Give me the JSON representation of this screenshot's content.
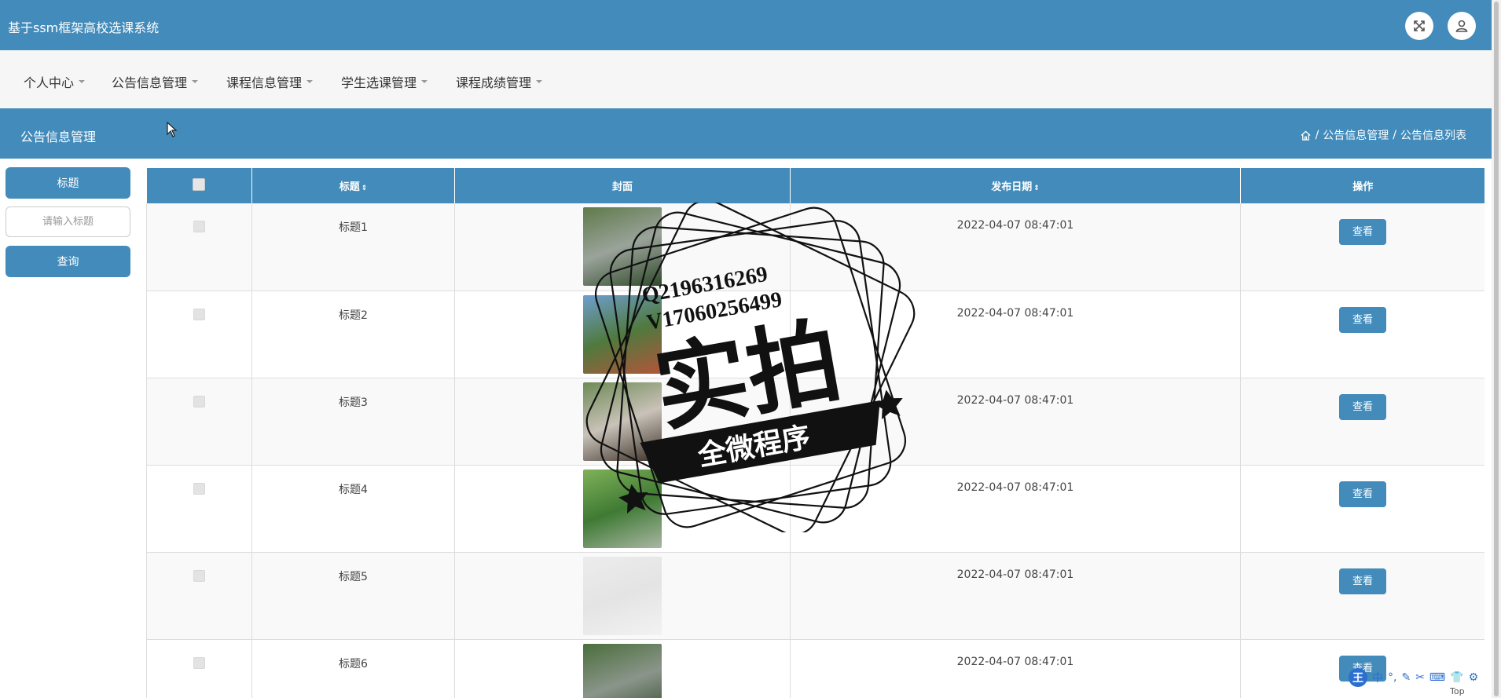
{
  "header": {
    "app_title": "基于ssm框架高校选课系统",
    "fullscreen_icon": "expand-icon",
    "user_icon": "user-icon"
  },
  "nav": {
    "items": [
      {
        "label": "个人中心"
      },
      {
        "label": "公告信息管理"
      },
      {
        "label": "课程信息管理"
      },
      {
        "label": "学生选课管理"
      },
      {
        "label": "课程成绩管理"
      }
    ]
  },
  "section": {
    "title": "公告信息管理",
    "breadcrumb": [
      "公告信息管理",
      "公告信息列表"
    ],
    "breadcrumb_separator": "/"
  },
  "search": {
    "label": "标题",
    "placeholder": "请输入标题",
    "query_button": "查询"
  },
  "table": {
    "columns": [
      "标题",
      "封面",
      "发布日期",
      "操作"
    ],
    "sort_icon": "⇕",
    "rows": [
      {
        "title": "标题1",
        "date": "2022-04-07 08:47:01",
        "action": "查看",
        "cover_colors": [
          "#5e7a4a",
          "#9aa39a",
          "#2f4a2a"
        ]
      },
      {
        "title": "标题2",
        "date": "2022-04-07 08:47:01",
        "action": "查看",
        "cover_colors": [
          "#6f9ed0",
          "#4f7a3e",
          "#b2553a"
        ]
      },
      {
        "title": "标题3",
        "date": "2022-04-07 08:47:01",
        "action": "查看",
        "cover_colors": [
          "#6d8a55",
          "#c9c2b8",
          "#3b3028"
        ]
      },
      {
        "title": "标题4",
        "date": "2022-04-07 08:47:01",
        "action": "查看",
        "cover_colors": [
          "#7fb158",
          "#3f7a34",
          "#a9b6a3"
        ]
      },
      {
        "title": "标题5",
        "date": "2022-04-07 08:47:01",
        "action": "查看",
        "cover_colors": [
          "#ececec",
          "#e4e4e4",
          "#f2f2f2"
        ]
      },
      {
        "title": "标题6",
        "date": "2022-04-07 08:47:01",
        "action": "查看",
        "cover_colors": [
          "#4a6e3c",
          "#8a958a",
          "#2d4727"
        ]
      }
    ]
  },
  "watermark": {
    "line1": "Q2196316269",
    "line2": "V17060256499",
    "big_text": "实拍",
    "banner_text": "全微程序"
  },
  "ime": {
    "logo": "王",
    "items": [
      "中",
      "°,",
      "✎",
      "✂",
      "⌨",
      "👕",
      "⚙"
    ],
    "top_label": "Top"
  }
}
